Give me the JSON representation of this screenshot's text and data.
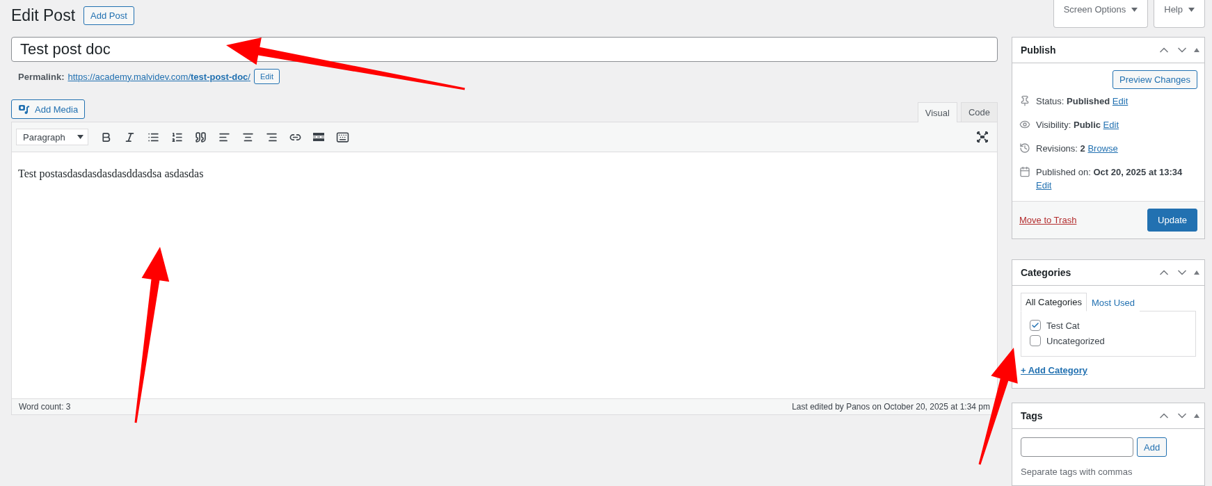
{
  "header": {
    "title": "Edit Post",
    "add_button": "Add Post"
  },
  "screen_meta": [
    {
      "label": "Screen Options"
    },
    {
      "label": "Help"
    }
  ],
  "post_title": {
    "value": "Test post doc"
  },
  "permalink": {
    "label": "Permalink:",
    "url": "https://academy.malvidev.com/**test-post-doc**/",
    "edit": "Edit"
  },
  "add_media": "Add Media",
  "editor_tabs": [
    {
      "label": "Visual",
      "selected": true
    },
    {
      "label": "Code",
      "selected": false
    }
  ],
  "format_select": "Paragraph",
  "content": "Test postasdasdasdasdasddasdsa asdasdas",
  "status_bar": {
    "word_count": "Word count: 3",
    "last_edited": "Last edited by Panos on October 20, 2025 at 1:34 pm"
  },
  "publish": {
    "title": "Publish",
    "preview": "Preview Changes",
    "rows": [
      {
        "kind": "status",
        "label": "Status:",
        "value": "Published",
        "link": "Edit"
      },
      {
        "kind": "visibility",
        "label": "Visibility:",
        "value": "Public",
        "link": "Edit"
      },
      {
        "kind": "revisions",
        "label": "Revisions:",
        "value": "2",
        "link": "Browse"
      },
      {
        "kind": "date",
        "label": "Published on:",
        "value": "Oct 20, 2025 at 13:34",
        "link": "Edit"
      }
    ],
    "trash": "Move to Trash",
    "update": "Update"
  },
  "categories": {
    "title": "Categories",
    "tabs": [
      {
        "label": "All Categories",
        "selected": true
      },
      {
        "label": "Most Used",
        "selected": false
      }
    ],
    "items": [
      {
        "label": "Test Cat",
        "checked": true
      },
      {
        "label": "Uncategorized",
        "checked": false
      }
    ],
    "add_link": "+ Add Category"
  },
  "tags": {
    "title": "Tags",
    "button": "Add",
    "hint": "Separate tags with commas"
  }
}
